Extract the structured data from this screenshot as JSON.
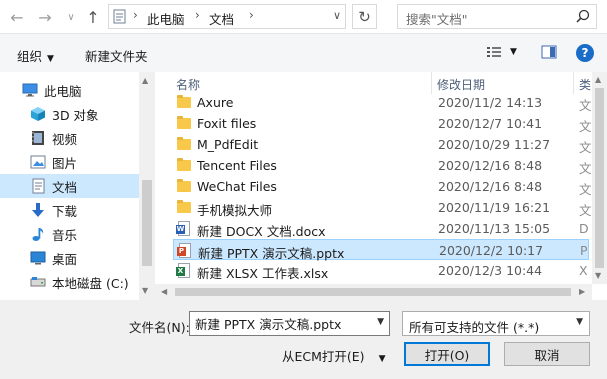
{
  "nav_buttons": {
    "back": "←",
    "forward": "→",
    "recent": "∨",
    "up": "↑"
  },
  "address": {
    "crumbs": [
      "此电脑",
      "文档"
    ],
    "separator": "›",
    "dropdown": "∨",
    "refresh": "↻"
  },
  "search": {
    "placeholder": "搜索\"文档\""
  },
  "toolbar": {
    "organize": "组织",
    "new_folder": "新建文件夹",
    "help": "?"
  },
  "sidebar": {
    "items": [
      {
        "label": "此电脑",
        "icon": "monitor-icon"
      },
      {
        "label": "3D 对象",
        "icon": "cube-3d-icon"
      },
      {
        "label": "视频",
        "icon": "video-icon"
      },
      {
        "label": "图片",
        "icon": "picture-icon"
      },
      {
        "label": "文档",
        "icon": "document-icon",
        "selected": true
      },
      {
        "label": "下载",
        "icon": "download-icon"
      },
      {
        "label": "音乐",
        "icon": "music-icon"
      },
      {
        "label": "桌面",
        "icon": "desktop-icon"
      },
      {
        "label": "本地磁盘 (C:)",
        "icon": "drive-icon"
      }
    ]
  },
  "file_list": {
    "columns": {
      "name": "名称",
      "date": "修改日期",
      "type": "类"
    },
    "rows": [
      {
        "name": "Axure",
        "date": "2020/11/2 14:13",
        "type": "文",
        "icon": "folder-icon"
      },
      {
        "name": "Foxit files",
        "date": "2020/12/7 10:41",
        "type": "文",
        "icon": "folder-icon"
      },
      {
        "name": "M_PdfEdit",
        "date": "2020/10/29 11:27",
        "type": "文",
        "icon": "folder-icon"
      },
      {
        "name": "Tencent Files",
        "date": "2020/12/16 8:48",
        "type": "文",
        "icon": "folder-icon"
      },
      {
        "name": "WeChat Files",
        "date": "2020/12/16 8:48",
        "type": "文",
        "icon": "folder-icon"
      },
      {
        "name": "手机模拟大师",
        "date": "2020/11/19 16:21",
        "type": "文",
        "icon": "folder-icon"
      },
      {
        "name": "新建 DOCX 文档.docx",
        "date": "2020/11/13 15:05",
        "type": "D",
        "icon": "word-doc-icon"
      },
      {
        "name": "新建 PPTX 演示文稿.pptx",
        "date": "2020/12/2 10:17",
        "type": "P",
        "icon": "powerpoint-doc-icon",
        "selected": true
      },
      {
        "name": "新建 XLSX 工作表.xlsx",
        "date": "2020/12/3 10:44",
        "type": "X",
        "icon": "excel-doc-icon"
      }
    ]
  },
  "bottom": {
    "filename_label": "文件名(N):",
    "filename_value": "新建 PPTX 演示文稿.pptx",
    "filter_value": "所有可支持的文件 (*.*)",
    "ecm_label": "从ECM打开(E)",
    "open_label": "打开(O)",
    "cancel_label": "取消"
  },
  "colors": {
    "selection": "#cce8ff",
    "accent": "#0078d7",
    "folder": "#f7c84a"
  }
}
